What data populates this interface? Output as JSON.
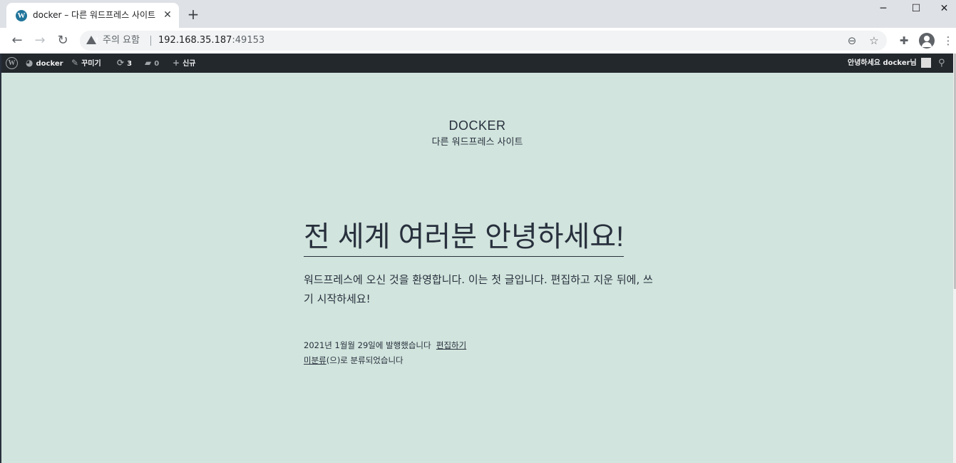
{
  "browser": {
    "tab": {
      "title": "docker – 다른 워드프레스 사이트",
      "favicon": "W"
    },
    "security_label": "주의 요함",
    "url_host": "192.168.35.187",
    "url_port": ":49153"
  },
  "admin_bar": {
    "site_name": "docker",
    "customize": "꾸미기",
    "updates_count": "3",
    "comments_count": "0",
    "new_label": "신규",
    "greeting": "안녕하세요 docker님"
  },
  "site": {
    "title": "DOCKER",
    "description": "다른 워드프레스 사이트"
  },
  "post": {
    "title": "전 세계 여러분 안녕하세요!",
    "body": "워드프레스에 오신 것을 환영합니다. 이는 첫 글입니다. 편집하고 지운 뒤에, 쓰기 시작하세요!",
    "published": "2021년 1월월 29일에 발행했습니다",
    "edit_link": "편집하기",
    "category": "미분류",
    "category_suffix": "(으)로 분류되었습니다"
  }
}
